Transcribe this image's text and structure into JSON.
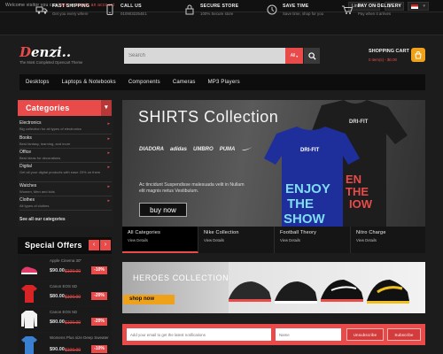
{
  "topbar": {
    "welcome_prefix": "Welcome visitor you can",
    "login_link": "login",
    "or": "or",
    "register_link": "create an account",
    "language": "Links",
    "currency": "$",
    "flag": "flag-icon"
  },
  "features": [
    {
      "icon": "truck-icon",
      "title": "Fast Shipping",
      "sub": "Get you every where"
    },
    {
      "icon": "phone-icon",
      "title": "Call us",
      "sub": "0109032254E1"
    },
    {
      "icon": "lock-icon",
      "title": "Secure Store",
      "sub": "100% Secure store"
    },
    {
      "icon": "clock-icon",
      "title": "Save time",
      "sub": "Save time, shop for you"
    },
    {
      "icon": "cart-icon",
      "title": "Pay on delivery",
      "sub": "Pay when it arrives"
    }
  ],
  "header": {
    "logo_first": "D",
    "logo_rest": "enzi..",
    "tagline": "The Most Completed Opencart Theme",
    "search_placeholder": "Search",
    "category_label": "All",
    "cart_label": "Shopping Cart",
    "cart_value": "0 item(s) - $0.00"
  },
  "nav": [
    "Desktops",
    "Laptops & Notebooks",
    "Components",
    "Cameras",
    "MP3 Players"
  ],
  "categories": {
    "title": "Categories",
    "toggle": "▾",
    "items": [
      {
        "name": "Electronics",
        "desc": "Big collection for all types of electronics"
      },
      {
        "name": "Books",
        "desc": "Best fantasy, learning, and more"
      },
      {
        "name": "Office",
        "desc": "Best ideas for decorations"
      },
      {
        "name": "Digital",
        "desc": "Get all your digital products with ease 20% on them"
      },
      {
        "name": "Watches",
        "desc": "Women, Men and kids"
      },
      {
        "name": "Clothes",
        "desc": "All types of clothes"
      }
    ],
    "see_all": "See all our categories"
  },
  "special_offers": {
    "title": "Special Offers",
    "prev": "‹",
    "next": "›",
    "items": [
      {
        "name": "Apple Cinema 30\"",
        "price": "$90.00",
        "old": "$100.00",
        "disc": "-10%",
        "color": "#e23b6a",
        "kind": "shoe"
      },
      {
        "name": "Canon EOS 5D",
        "price": "$80.00",
        "old": "$100.00",
        "disc": "-20%",
        "color": "#d82424",
        "kind": "shirt"
      },
      {
        "name": "Canon EOS 5D",
        "price": "$80.00",
        "old": "$100.00",
        "disc": "-20%",
        "color": "#f2f2f2",
        "kind": "shirt"
      },
      {
        "name": "Womens Plus size Deep Sweater",
        "price": "$90.00",
        "old": "$100.00",
        "disc": "-10%",
        "color": "#3b7fd1",
        "kind": "shirt"
      }
    ]
  },
  "banner": {
    "title": "SHIRTS Collection",
    "brands": [
      "DIADORA",
      "adidas",
      "UMBRO",
      "PUMA",
      "Nike"
    ],
    "text": "Ac tincidunt Suspendisse malesuada velit in Nullam elit magnis netus Vestibulum.",
    "button": "buy now",
    "shirt_print": "ENJOY THE SHOW",
    "shirt_logo": "DRI-FIT",
    "tabs": [
      {
        "title": "All Categories",
        "detail": "View Details"
      },
      {
        "title": "Nike Collection",
        "detail": "View Details"
      },
      {
        "title": "Football Theory",
        "detail": "View Details"
      },
      {
        "title": "Nitro Charge",
        "detail": "View Details"
      }
    ]
  },
  "heroes": {
    "title": "HEROES COLLECTION",
    "button": "shop now"
  },
  "newsletter": {
    "email_placeholder": "Add your email to get the latest notifications",
    "name_placeholder": "Name",
    "unsubscribe": "Unsubscribe",
    "subscribe": "Subscribe"
  },
  "colors": {
    "accent": "#e94b4b",
    "orange": "#f0a11a",
    "background": "#1c1c1c"
  }
}
